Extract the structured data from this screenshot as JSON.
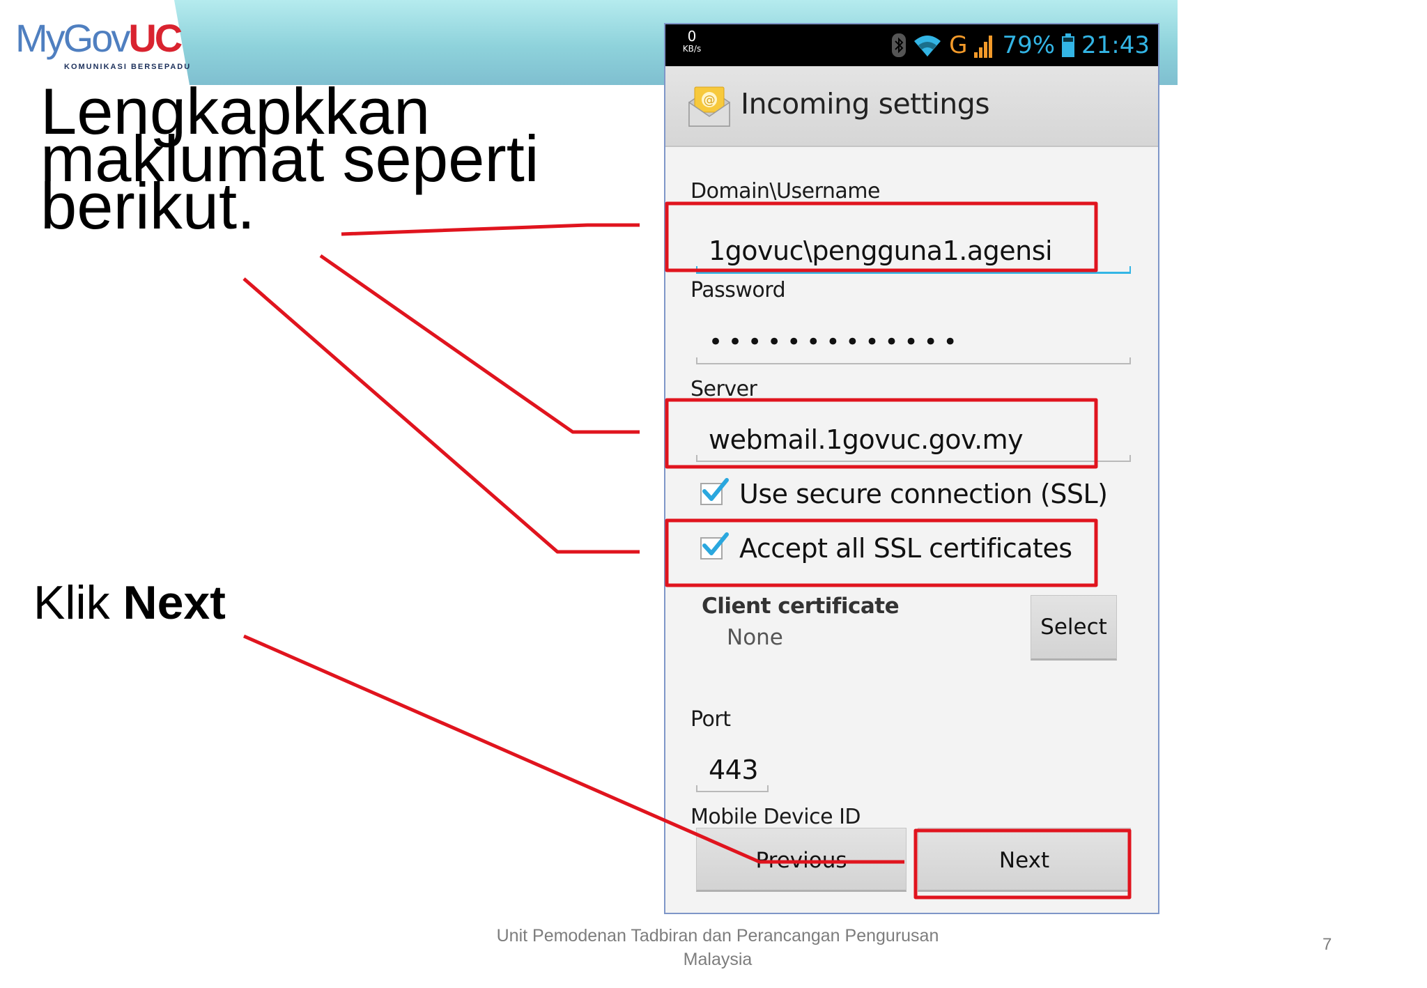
{
  "slide": {
    "logo": {
      "brand_prefix": "MyGov",
      "brand_suffix": "UC",
      "tagline": "KOMUNIKASI BERSEPADU"
    },
    "heading": "Lengkapkkan maklumat seperti berikut.",
    "instruction": {
      "prefix": "Klik ",
      "emphasis": "Next"
    },
    "footer": {
      "line1": "Unit Pemodenan Tadbiran dan Perancangan Pengurusan",
      "line2": "Malaysia"
    },
    "page_number": "7",
    "colors": {
      "annotation": "#e0141e",
      "band": "#8ed2db",
      "accent": "#33b5e5"
    }
  },
  "phone": {
    "status_bar": {
      "speed_value": "0",
      "speed_unit": "KB/s",
      "network_type": "G",
      "battery": "79%",
      "time": "21:43",
      "icons": [
        "bluetooth-icon",
        "wifi-icon",
        "signal-icon",
        "battery-icon"
      ]
    },
    "header": {
      "title": "Incoming settings",
      "icon": "email-app-icon"
    },
    "form": {
      "username": {
        "label": "Domain\\Username",
        "value": "1govuc\\pengguna1.agensi"
      },
      "password": {
        "label": "Password",
        "value": "•••••••••••••"
      },
      "server": {
        "label": "Server",
        "value": "webmail.1govuc.gov.my"
      },
      "ssl": {
        "label": "Use secure connection (SSL)",
        "checked": true
      },
      "accept_all": {
        "label": "Accept all SSL certificates",
        "checked": true
      },
      "client_certificate": {
        "label": "Client certificate",
        "value": "None",
        "button": "Select"
      },
      "port": {
        "label": "Port",
        "value": "443"
      },
      "device_id": {
        "label": "Mobile Device ID"
      }
    },
    "buttons": {
      "previous": "Previous",
      "next": "Next"
    }
  }
}
